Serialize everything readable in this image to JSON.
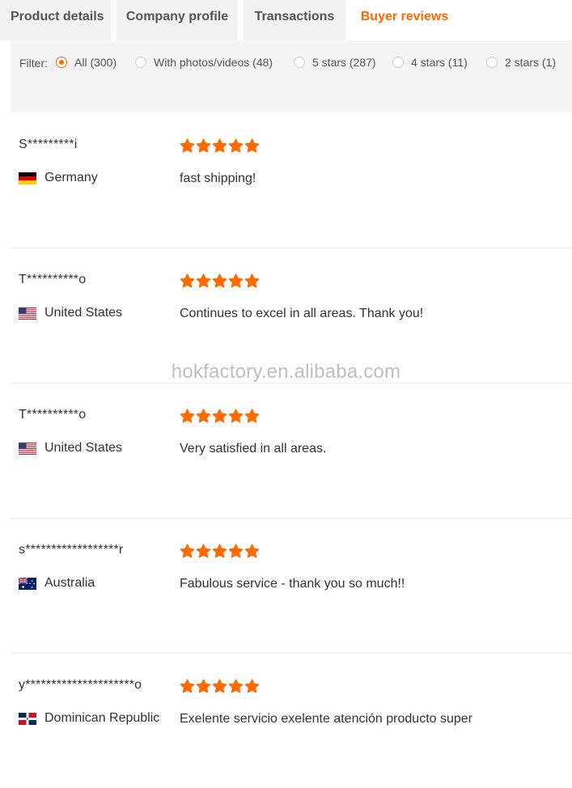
{
  "tabs": [
    {
      "label": "Product details",
      "active": false
    },
    {
      "label": "Company profile",
      "active": false
    },
    {
      "label": "Transactions",
      "active": false
    },
    {
      "label": "Buyer reviews",
      "active": true
    }
  ],
  "filter": {
    "label": "Filter:",
    "options": [
      {
        "label": "All (300)",
        "checked": true
      },
      {
        "label": "With photos/videos (48)",
        "checked": false
      },
      {
        "label": "5 stars (287)",
        "checked": false
      },
      {
        "label": "4 stars (11)",
        "checked": false
      },
      {
        "label": "2 stars (1)",
        "checked": false
      }
    ]
  },
  "reviews": [
    {
      "buyer": "S*********i",
      "country": "Germany",
      "flag": "de",
      "rating": 5,
      "comment": "fast shipping!"
    },
    {
      "buyer": "T**********o",
      "country": "United States",
      "flag": "us",
      "rating": 5,
      "comment": "Continues to excel in all areas. Thank you!"
    },
    {
      "buyer": "T**********o",
      "country": "United States",
      "flag": "us",
      "rating": 5,
      "comment": "Very satisfied in all areas."
    },
    {
      "buyer": "s******************r",
      "country": "Australia",
      "flag": "au",
      "rating": 5,
      "comment": "Fabulous service - thank you so much!!"
    },
    {
      "buyer": "y*********************o",
      "country": "Dominican Republic",
      "flag": "do",
      "rating": 5,
      "comment": "Exelente servicio exelente atención producto super"
    }
  ],
  "watermark": "hokfactory.en.alibaba.com",
  "colors": {
    "accent": "#ff6a00",
    "star": "#ff6a00"
  }
}
